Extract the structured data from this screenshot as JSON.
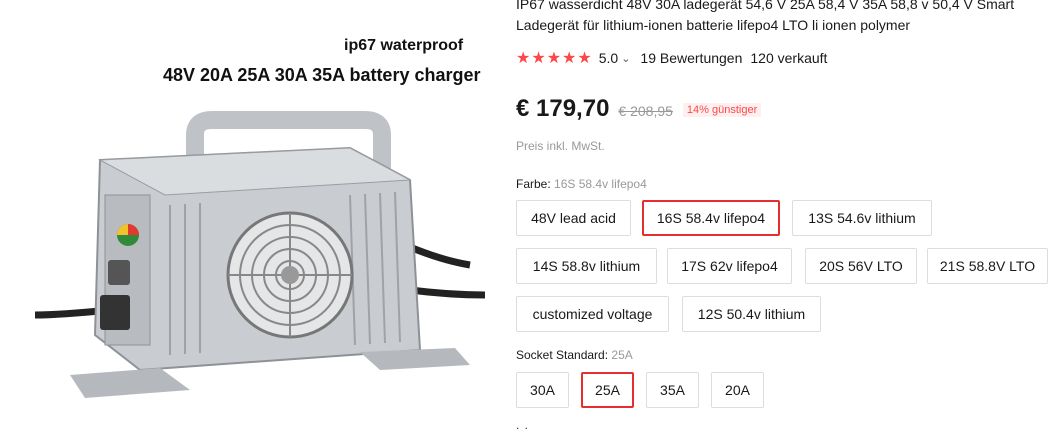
{
  "product_image": {
    "caption_line1": "ip67 waterproof",
    "caption_line2": "48V 20A 25A 30A 35A battery charger"
  },
  "product": {
    "title": "IP67 wasserdicht 48V 30A ladegerät 54,6 V 25A 58,4 V 35A 58,8 v 50,4 V Smart Ladegerät für lithium-ionen batterie lifepo4 LTO li ionen polymer",
    "stars": "★★★★★",
    "rating": "5.0",
    "reviews": "19 Bewertungen",
    "sold": "120 verkauft",
    "price": "€ 179,70",
    "old_price": "€ 208,95",
    "discount": "14% günstiger",
    "tax_note": "Preis inkl. MwSt."
  },
  "color_selector": {
    "label": "Farbe:",
    "selected": "16S 58.4v lifepo4",
    "options": [
      "48V lead acid",
      "16S 58.4v lifepo4",
      "13S 54.6v lithium",
      "14S 58.8v lithium",
      "17S 62v lifepo4",
      "20S 56V LTO",
      "21S 58.8V LTO",
      "customized voltage",
      "12S 50.4v lithium"
    ]
  },
  "socket_selector": {
    "label": "Socket Standard:",
    "selected": "25A",
    "options": [
      "30A",
      "25A",
      "35A",
      "20A"
    ]
  },
  "more_indicator": ". .",
  "colors": {
    "accent_red": "#ff4747",
    "active_border": "#e62e2e"
  }
}
